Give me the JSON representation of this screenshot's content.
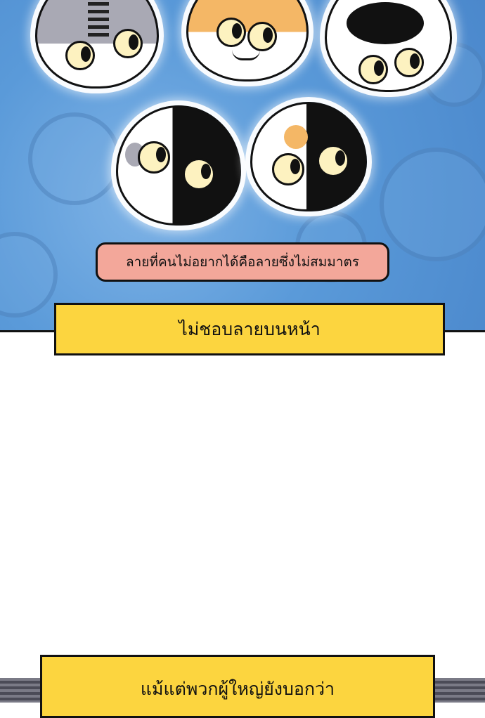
{
  "panel_top": {
    "pink_bubble_text": "ลายที่คนไม่อยากได้คือลายซึ่งไม่สมมาตร",
    "caption_text": "ไม่ชอบลายบนหน้า"
  },
  "panel_bottom": {
    "caption_line1": "แม้แต่พวกผู้ใหญ่ยังบอกว่า"
  },
  "colors": {
    "background_blue": "#5a9ad9",
    "caption_yellow": "#fcd53f",
    "bubble_pink": "#f3a79a"
  }
}
